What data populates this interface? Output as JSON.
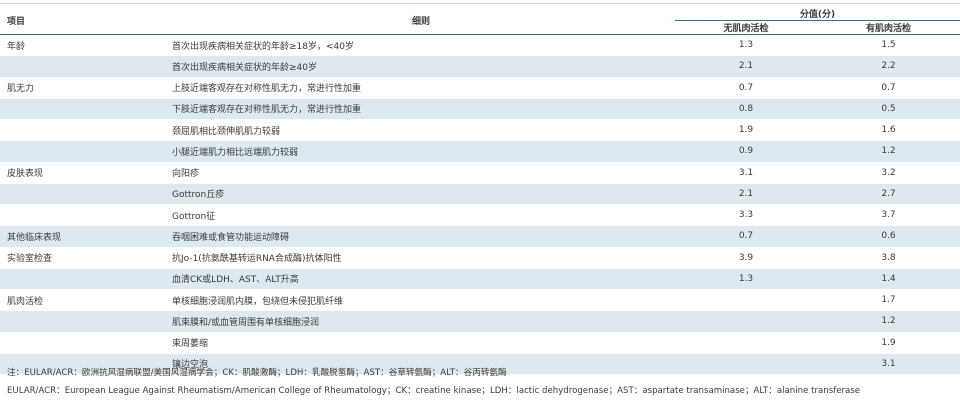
{
  "table": {
    "headers": {
      "item": "项目",
      "detail": "细则",
      "score": "分值(分)",
      "without_biopsy": "无肌肉活检",
      "with_biopsy": "有肌肉活检"
    },
    "rows": [
      {
        "category": "年龄",
        "detail": "首次出现疾病相关症状的年龄≥18岁，<40岁",
        "without_biopsy": "1.3",
        "with_biopsy": "1.5"
      },
      {
        "category": "",
        "detail": "首次出现疾病相关症状的年龄≥40岁",
        "without_biopsy": "2.1",
        "with_biopsy": "2.2"
      },
      {
        "category": "肌无力",
        "detail": "上肢近端客观存在对称性肌无力，常进行性加重",
        "without_biopsy": "0.7",
        "with_biopsy": "0.7"
      },
      {
        "category": "",
        "detail": "下肢近端客观存在对称性肌无力，常进行性加重",
        "without_biopsy": "0.8",
        "with_biopsy": "0.5"
      },
      {
        "category": "",
        "detail": "颈屈肌相比颈伸肌肌力较弱",
        "without_biopsy": "1.9",
        "with_biopsy": "1.6"
      },
      {
        "category": "",
        "detail": "小腿近端肌力相比远端肌力较弱",
        "without_biopsy": "0.9",
        "with_biopsy": "1.2"
      },
      {
        "category": "皮肤表现",
        "detail": "向阳疹",
        "without_biopsy": "3.1",
        "with_biopsy": "3.2"
      },
      {
        "category": "",
        "detail": "Gottron丘疹",
        "without_biopsy": "2.1",
        "with_biopsy": "2.7"
      },
      {
        "category": "",
        "detail": "Gottron征",
        "without_biopsy": "3.3",
        "with_biopsy": "3.7"
      },
      {
        "category": "其他临床表现",
        "detail": "吞咽困难或食管功能运动障碍",
        "without_biopsy": "0.7",
        "with_biopsy": "0.6"
      },
      {
        "category": "实验室检查",
        "detail": "抗Jo-1(抗氨酰基转运RNA合成酶)抗体阳性",
        "without_biopsy": "3.9",
        "with_biopsy": "3.8"
      },
      {
        "category": "",
        "detail": "血清CK或LDH、AST、ALT升高",
        "without_biopsy": "1.3",
        "with_biopsy": "1.4"
      },
      {
        "category": "肌肉活检",
        "detail": "单核细胞浸润肌内膜，包绕但未侵犯肌纤维",
        "without_biopsy": "",
        "with_biopsy": "1.7"
      },
      {
        "category": "",
        "detail": "肌束膜和/或血管周围有单核细胞浸润",
        "without_biopsy": "",
        "with_biopsy": "1.2"
      },
      {
        "category": "",
        "detail": "束周萎缩",
        "without_biopsy": "",
        "with_biopsy": "1.9"
      },
      {
        "category": "",
        "detail": "镶边空泡",
        "without_biopsy": "",
        "with_biopsy": "3.1"
      }
    ]
  },
  "notes": {
    "chinese": "注：EULAR/ACR：欧洲抗风湿病联盟/美国风湿病学会；CK：肌酸激酶；LDH：乳酸脱氢酶；AST：谷草转氨酶；ALT：谷丙转氨酶",
    "english": "EULAR/ACR：European League Against Rheumatism/American College of Rheumatology；CK：creatine kinase；LDH：lactic dehydrogenase；AST：aspartate transaminase；ALT：alanine transferase"
  },
  "colors": {
    "row_shade": "#dde9f1",
    "rule": "#3b6f8e",
    "text": "#3a3a3a"
  }
}
